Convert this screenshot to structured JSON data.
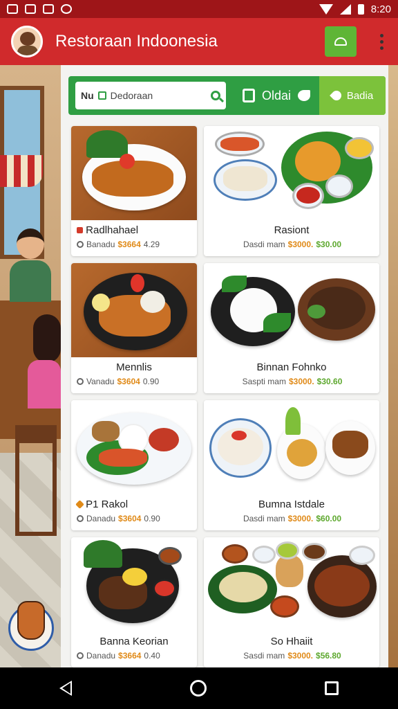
{
  "status_bar": {
    "time": "8:20"
  },
  "app_bar": {
    "title": "Restoraan Indoonesia"
  },
  "tabs": {
    "search_prefix": "Nu",
    "search_placeholder": "Dedoraan",
    "order_label": "Oldai",
    "active_label": "Badia"
  },
  "menu_items": [
    {
      "title": "Radlhahael",
      "meta_label": "Banadu",
      "price": "$3664",
      "extra": "4.29"
    },
    {
      "title": "Rasiont",
      "meta_label": "Dasdi mam",
      "price": "$3000.",
      "extra": "$30.00"
    },
    {
      "title": "Mennlis",
      "meta_label": "Vanadu",
      "price": "$3604",
      "extra": "0.90"
    },
    {
      "title": "Binnan Fohnko",
      "meta_label": "Saspti mam",
      "price": "$3000.",
      "extra": "$30.60"
    },
    {
      "title": "P1 Rakol",
      "meta_label": "Danadu",
      "price": "$3604",
      "extra": "0.90"
    },
    {
      "title": "Bumna Istdale",
      "meta_label": "Dasdi mam",
      "price": "$3000.",
      "extra": "$60.00"
    },
    {
      "title": "Banna Keorian",
      "meta_label": "Danadu",
      "price": "$3664",
      "extra": "0.40"
    },
    {
      "title": "So Hhaiit",
      "meta_label": "Sasdi mam",
      "price": "$3000.",
      "extra": "$56.80"
    }
  ],
  "colors": {
    "status_bar": "#9e1518",
    "app_bar": "#d02a2c",
    "tab_green": "#2f9e43",
    "tab_active": "#7cc23b",
    "price_orange": "#e08a18",
    "price_green": "#5da82e"
  }
}
